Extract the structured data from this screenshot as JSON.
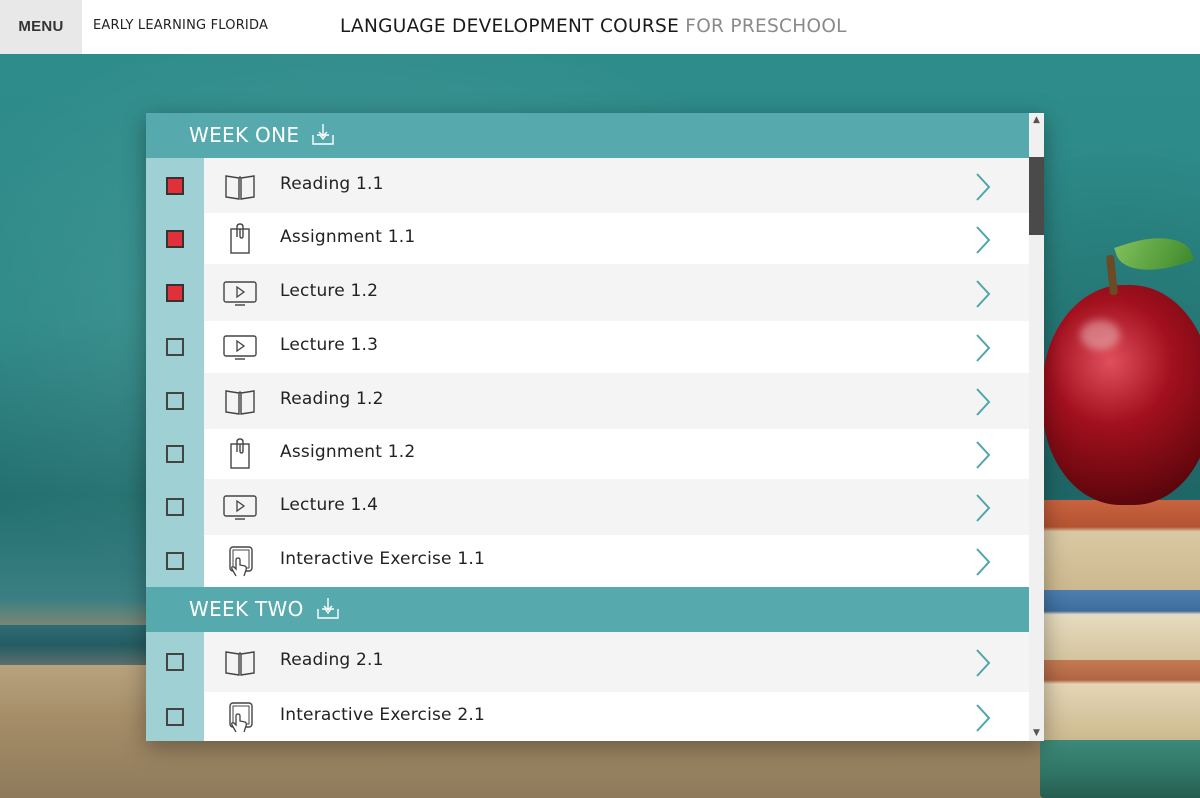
{
  "header": {
    "menu_label": "MENU",
    "org_name": "EARLY LEARNING FLORIDA",
    "course_title": "LANGUAGE DEVELOPMENT COURSE",
    "course_audience": "FOR PRESCHOOL"
  },
  "weeks": [
    {
      "title": "WEEK ONE",
      "items": [
        {
          "label": "Reading 1.1",
          "type": "reading",
          "completed": true
        },
        {
          "label": "Assignment 1.1",
          "type": "assignment",
          "completed": true
        },
        {
          "label": "Lecture 1.2",
          "type": "lecture",
          "completed": true
        },
        {
          "label": "Lecture 1.3",
          "type": "lecture",
          "completed": false
        },
        {
          "label": "Reading 1.2",
          "type": "reading",
          "completed": false
        },
        {
          "label": "Assignment 1.2",
          "type": "assignment",
          "completed": false
        },
        {
          "label": "Lecture 1.4",
          "type": "lecture",
          "completed": false
        },
        {
          "label": "Interactive Exercise 1.1",
          "type": "interactive",
          "completed": false
        }
      ]
    },
    {
      "title": "WEEK TWO",
      "items": [
        {
          "label": "Reading 2.1",
          "type": "reading",
          "completed": false
        },
        {
          "label": "Interactive Exercise 2.1",
          "type": "interactive",
          "completed": false
        }
      ]
    }
  ],
  "icons": {
    "reading": "open-book-icon",
    "assignment": "clipboard-clip-icon",
    "lecture": "video-play-icon",
    "interactive": "touch-tablet-icon",
    "download": "download-tray-icon",
    "open": "chevron-right-icon"
  },
  "colors": {
    "week_header": "#56aaae",
    "checkbox_column": "#9fd0d3",
    "completed": "#e0303a",
    "chevron": "#4ea6ab",
    "row_alt": "#f4f4f4"
  }
}
